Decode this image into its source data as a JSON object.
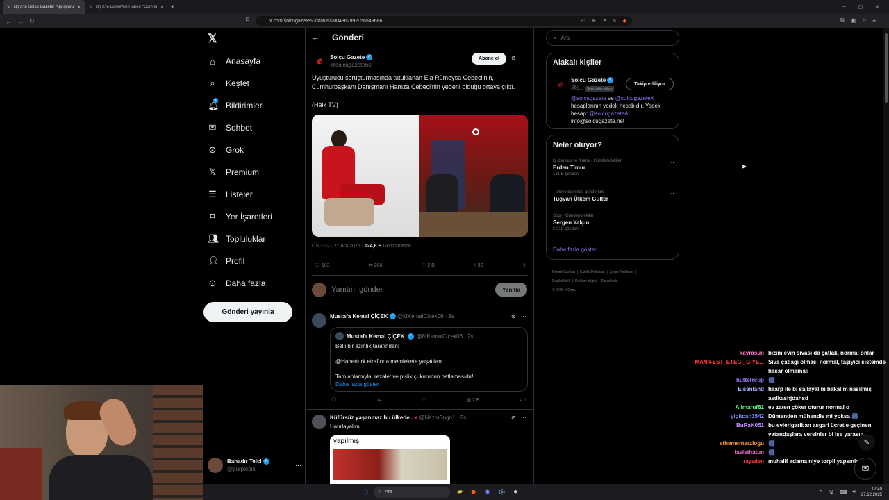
{
  "browser": {
    "tabs": [
      {
        "label": "(1) X'te Solcu Gazete: \"Uyuşturu..."
      },
      {
        "label": "(1) X'te DarkWeb Haber: \"Cumhurba..."
      }
    ],
    "url": "x.com/solcugazete60/status/2004862992056549686"
  },
  "sidebar": {
    "items": [
      {
        "label": "Anasayfa"
      },
      {
        "label": "Keşfet"
      },
      {
        "label": "Bildirimler"
      },
      {
        "label": "Sohbet"
      },
      {
        "label": "Grok"
      },
      {
        "label": "Premium"
      },
      {
        "label": "Listeler"
      },
      {
        "label": "Yer İşaretleri"
      },
      {
        "label": "Topluluklar"
      },
      {
        "label": "Profil"
      },
      {
        "label": "Daha fazla"
      }
    ],
    "notif_badge": "1",
    "post_button": "Gönderi yayınla",
    "account": {
      "name": "Bahadır Telci",
      "handle": "@purplebixi"
    }
  },
  "main": {
    "header": "Gönderi",
    "post": {
      "author": "Solcu Gazete",
      "handle": "@solcugazete60",
      "subscribe": "Abone ol",
      "text1": "Uyuşturucu soruşturmasında tutuklanan Ela Rümeysa Cebeci'nin, Cumhurbaşkanı Danışmanı Hamza Cebeci'nin yeğeni olduğu ortaya çıktı.",
      "text2": "(Halk TV)",
      "time": "ÖS 1:32 · 27 Ara 2025 ·",
      "views": "124,6 B",
      "views_label": "Görüntüleme",
      "replies": "103",
      "reposts": "286",
      "likes": "2 B",
      "bookmarks": "90"
    },
    "reply_box": {
      "placeholder": "Yanıtını gönder",
      "button": "Yanıtla"
    },
    "reply1": {
      "author": "Mustafa Kemal ÇİÇEK",
      "handle": "@MKemalCicek06 · 2s",
      "quote_author": "Mustafa Kemal ÇİÇEK",
      "quote_handle": "@MKemalCicek06 · 2s",
      "q1": "Belli bir azınlık tarafından!",
      "q2": "@Haberturk etrafında memlekete yaşatılan!",
      "q3": "Tam anlamıyla, rezalet ve pislik çukurunun patlamasıdır!...",
      "more": "Daha fazla göster",
      "views": "2 B"
    },
    "reply2": {
      "author": "Küfürsüz yaşanmaz bu ülkede..",
      "handle": "@NazmSngn1 · 2s",
      "text": "Hatırlayalım..",
      "img_caption": "yapılmış"
    }
  },
  "right": {
    "search_placeholder": "Ara",
    "people": {
      "title": "Alakalı kişiler",
      "name": "Solcu Gazete",
      "handle": "@s...",
      "follows_you": "Seni takip ediyor",
      "follow_btn": "Takip ediliyor",
      "bio_a": "@solcugazete",
      "bio_and": "ve",
      "bio_b": "@solcugazeteX",
      "bio_c": "hesaplarının yedek hesabıdır. Yedek hesap:",
      "bio_d": "@solcugazeteA",
      "bio_e": "info@solcugazete.net"
    },
    "trends": {
      "title": "Neler oluyor?",
      "items": [
        {
          "category": "İş dünyası ve finans · Gündemdekiler",
          "name": "Erden Timur",
          "count": "121 B gönderi"
        },
        {
          "category": "Türkiye tarihinde gündemde",
          "name": "Tuğyan Ülkem Gülter",
          "count": ""
        },
        {
          "category": "Spor · Gündemdekiler",
          "name": "Sergen Yalçın",
          "count": "2.518 gönderi"
        }
      ],
      "more": "Daha fazla göster"
    },
    "footer": [
      "Hizmet Şartları",
      "Gizlilik Politikası",
      "Çerez Politikası",
      "Erişilebilirlik",
      "Reklam bilgisi",
      "Daha fazla ···",
      "© 2025 X Corp."
    ]
  },
  "chat": [
    {
      "user": "kayrasun",
      "color": "#ff7fd0",
      "msg": "bizim evin sıvası da çatlak, normal onlar"
    },
    {
      "user": "MANIFEST_ETEGI_GIYE...",
      "color": "#ff3b3b",
      "msg": "Sıva çatlağı olması normal, taşıyıcı sistemde hasar olmamalı"
    },
    {
      "user": "butterrcup",
      "color": "#9a7cff",
      "msg": "🎆"
    },
    {
      "user": "Eisenland",
      "color": "#aab4ff",
      "msg": "haarp ile bi sallayalım bakalım nasılmış asdkashjdahsd"
    },
    {
      "user": "Alimaruf61",
      "color": "#5cff8a",
      "msg": "ev zaten çöker oturur normal o"
    },
    {
      "user": "yigitcan3542",
      "color": "#7f8cff",
      "msg": "Dümenden mühendis mi yoksa 🎆"
    },
    {
      "user": "BuRaK051",
      "color": "#c08bff",
      "msg": "bu evlerigariban asgari ücretle geçinen vatandaşlara versinler bi işe yarasın"
    },
    {
      "user": "ethementerziogu",
      "color": "#ff9a3b",
      "msg": "🎆"
    },
    {
      "user": "fasisthatun",
      "color": "#ff6fd8",
      "msg": "🎆"
    },
    {
      "user": "raywien",
      "color": "#ff3b3b",
      "msg": "muhalif adama niye torpil yapsınlar aq"
    }
  ],
  "taskbar": {
    "search": "Ara",
    "time": "17:40",
    "date": "27.12.2025"
  },
  "colors": {
    "accent": "#1d9bf0",
    "link": "#8b7cf5",
    "bg": "#000000"
  }
}
